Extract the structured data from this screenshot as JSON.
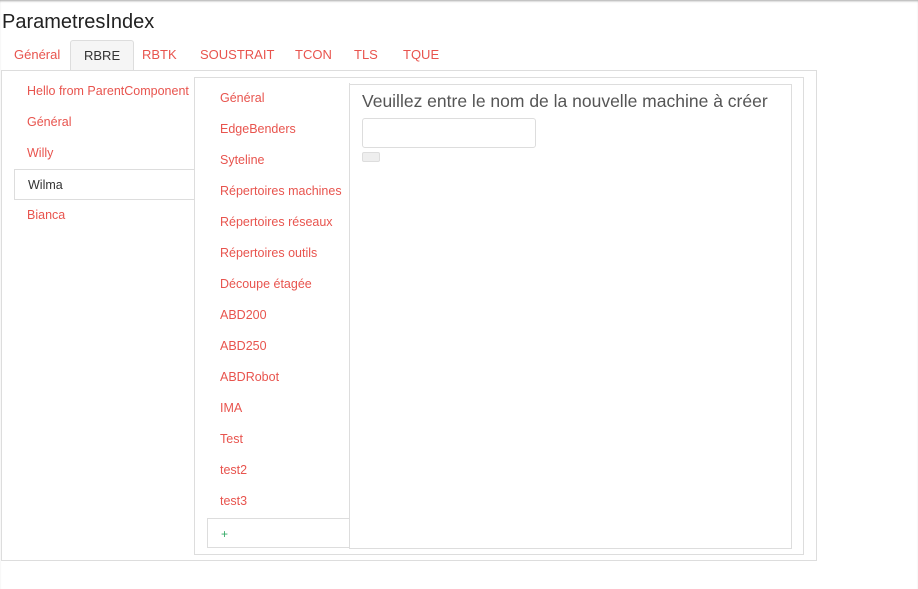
{
  "page": {
    "title": "ParametresIndex"
  },
  "tabs": [
    {
      "label": "Général"
    },
    {
      "label": "RBRE",
      "active": true
    },
    {
      "label": "RBTK"
    },
    {
      "label": "SOUSTRAIT"
    },
    {
      "label": "TCON"
    },
    {
      "label": "TLS"
    },
    {
      "label": "TQUE"
    }
  ],
  "components": {
    "items": [
      {
        "label": "Hello from ParentComponent"
      },
      {
        "label": "Général"
      },
      {
        "label": "Willy"
      },
      {
        "label": "Wilma",
        "active": true
      },
      {
        "label": "Bianca"
      }
    ]
  },
  "machines": {
    "items": [
      {
        "label": "Général"
      },
      {
        "label": "EdgeBenders"
      },
      {
        "label": "Syteline"
      },
      {
        "label": "Répertoires machines"
      },
      {
        "label": "Répertoires réseaux"
      },
      {
        "label": "Répertoires outils"
      },
      {
        "label": "Découpe étagée"
      },
      {
        "label": "ABD200"
      },
      {
        "label": "ABD250"
      },
      {
        "label": "ABDRobot"
      },
      {
        "label": "IMA"
      },
      {
        "label": "Test"
      },
      {
        "label": "test2"
      },
      {
        "label": "test3"
      }
    ],
    "add_label": "+"
  },
  "form": {
    "prompt": "Veuillez entre le nom de la nouvelle machine à créer",
    "name_value": "",
    "name_placeholder": "",
    "submit_label": ""
  },
  "colors": {
    "link": "#e8544e",
    "add": "#3a6",
    "border": "#dddddd"
  }
}
